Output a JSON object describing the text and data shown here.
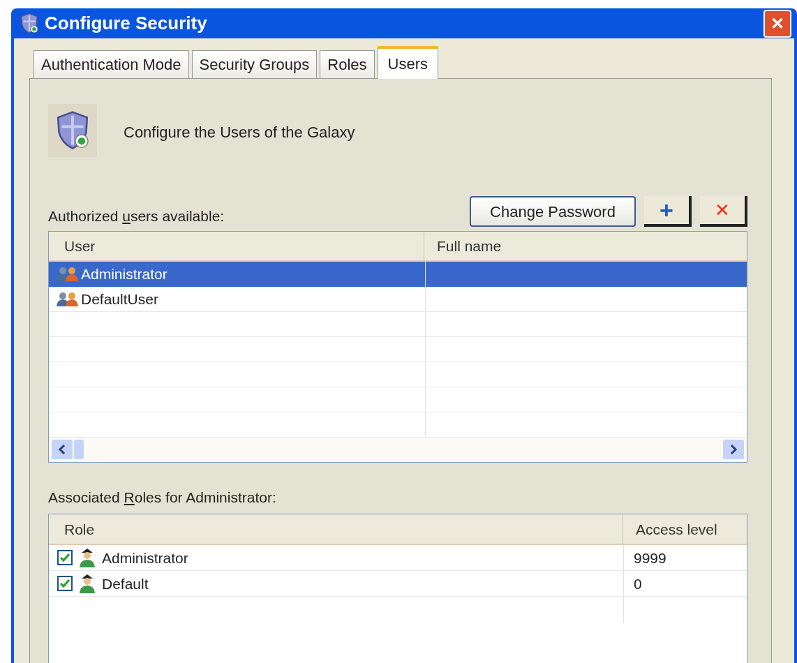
{
  "window": {
    "title": "Configure Security",
    "close_label": "✕"
  },
  "tabs": [
    {
      "label": "Authentication Mode",
      "selected": false
    },
    {
      "label": "Security Groups",
      "selected": false
    },
    {
      "label": "Roles",
      "selected": false
    },
    {
      "label": "Users",
      "selected": true
    }
  ],
  "header": {
    "text": "Configure the Users of the Galaxy"
  },
  "users_label": {
    "before": "Authorized ",
    "key": "u",
    "after": "sers available:"
  },
  "buttons": [
    {
      "kind": "text",
      "label": "Change Password"
    },
    {
      "kind": "add",
      "label": "+"
    },
    {
      "kind": "delete",
      "label": "✕"
    }
  ],
  "users_table": {
    "columns": [
      "User",
      "Full name"
    ],
    "rows": [
      {
        "user": "Administrator",
        "full_name": "",
        "selected": true
      },
      {
        "user": "DefaultUser",
        "full_name": "",
        "selected": false
      }
    ]
  },
  "roles_label": {
    "before": "Associated ",
    "key": "R",
    "after": "oles for Administrator:"
  },
  "roles_table": {
    "columns": [
      "Role",
      "Access level"
    ],
    "rows": [
      {
        "role": "Administrator",
        "access_level": "9999",
        "checked": true
      },
      {
        "role": "Default",
        "access_level": "0",
        "checked": true
      }
    ]
  }
}
